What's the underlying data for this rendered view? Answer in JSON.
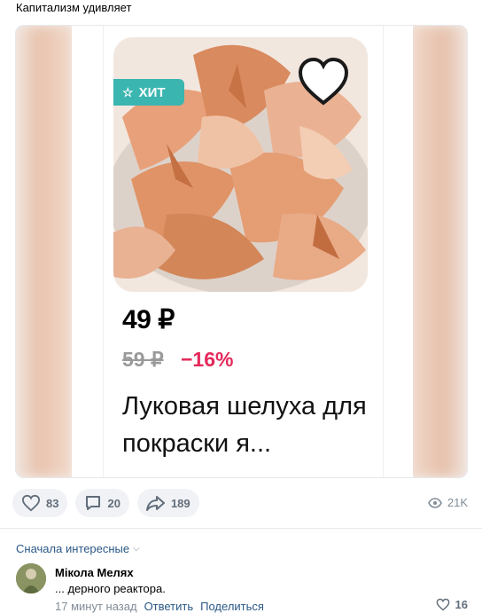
{
  "post": {
    "text": "Капитализм удивляет"
  },
  "product_card": {
    "badge": "ХИТ",
    "price": "49 ₽",
    "old_price": "59 ₽",
    "discount": "−16%",
    "title": "Луковая шелуха для покраски я..."
  },
  "actions": {
    "likes": "83",
    "comments": "20",
    "shares": "189",
    "views": "21K"
  },
  "comments_section": {
    "sort_label": "Сначала интересные",
    "comment": {
      "author": "Мікола Меляx",
      "text": "... дерного реактора.",
      "time": "17 минут назад",
      "reply_label": "Ответить",
      "share_label": "Поделиться",
      "likes": "16"
    }
  },
  "colors": {
    "badge": "#3bb5b0",
    "discount": "#e5295b",
    "link": "#2a5885"
  }
}
